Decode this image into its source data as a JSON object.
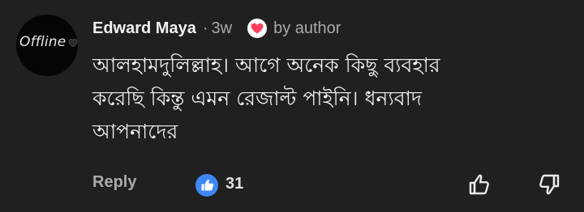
{
  "comment": {
    "avatar_text": "Offline",
    "author_name": "Edward Maya",
    "separator": "·",
    "time_ago": "3w",
    "author_heart_label": "by author",
    "lines": [
      "আলহামদুলিল্লাহ। আগে অনেক কিছু ব্যবহার",
      "করেছি কিন্তু এমন রেজাল্ট পাইনি। ধন্যবাদ",
      "আপনাদের"
    ]
  },
  "actions": {
    "reply_label": "Reply",
    "like_count": "31"
  },
  "colors": {
    "background": "#202020",
    "text_primary": "#f1f1f1",
    "text_secondary": "#aaaaaa",
    "like_blue": "#3e88f5",
    "heart_red": "#ff3d5a"
  },
  "icons": {
    "avatar_heart": "heart-icon",
    "author_heart": "heart-icon",
    "like_reaction": "thumbs-up-icon",
    "like_button": "thumbs-up-outline-icon",
    "dislike_button": "thumbs-down-outline-icon"
  }
}
